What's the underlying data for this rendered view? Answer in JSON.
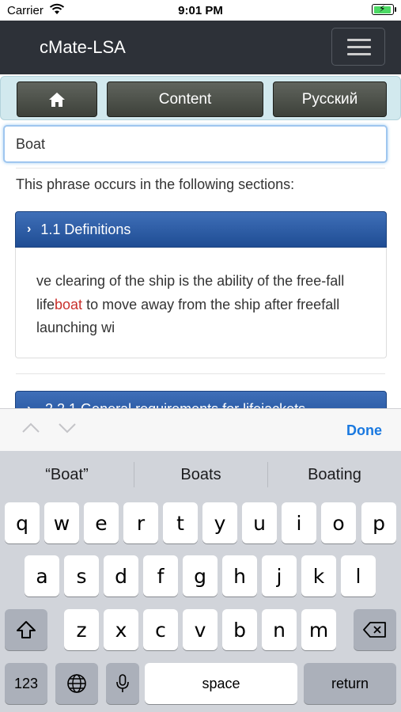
{
  "status": {
    "carrier": "Carrier",
    "time": "9:01 PM"
  },
  "navbar": {
    "brand": "cMate-LSA",
    "menu_icon": "hamburger-icon"
  },
  "toolbar": {
    "home_icon": "home-icon",
    "content_label": "Content",
    "language_label": "Русский"
  },
  "search": {
    "value": "Boat"
  },
  "results": {
    "intro": "This phrase occurs in the following sections:",
    "sections": [
      {
        "title": "1.1 Definitions",
        "snippet_before": "ve clearing of the ship is the ability of the free-fall life",
        "snippet_match": "boat",
        "snippet_after": " to move away from the ship after freefall launching wi"
      },
      {
        "title": "2.2.1 General requirements for lifejackets"
      }
    ]
  },
  "accessory": {
    "done_label": "Done"
  },
  "keyboard": {
    "suggestions": [
      "“Boat”",
      "Boats",
      "Boating"
    ],
    "row1": [
      "q",
      "w",
      "e",
      "r",
      "t",
      "y",
      "u",
      "i",
      "o",
      "p"
    ],
    "row2": [
      "a",
      "s",
      "d",
      "f",
      "g",
      "h",
      "j",
      "k",
      "l"
    ],
    "row3": [
      "z",
      "x",
      "c",
      "v",
      "b",
      "n",
      "m"
    ],
    "numbers_label": "123",
    "space_label": "space",
    "return_label": "return"
  },
  "colors": {
    "navbar": "#2d3138",
    "accent": "#1f4d94",
    "highlight": "#c9302c",
    "done": "#1a79e0"
  }
}
